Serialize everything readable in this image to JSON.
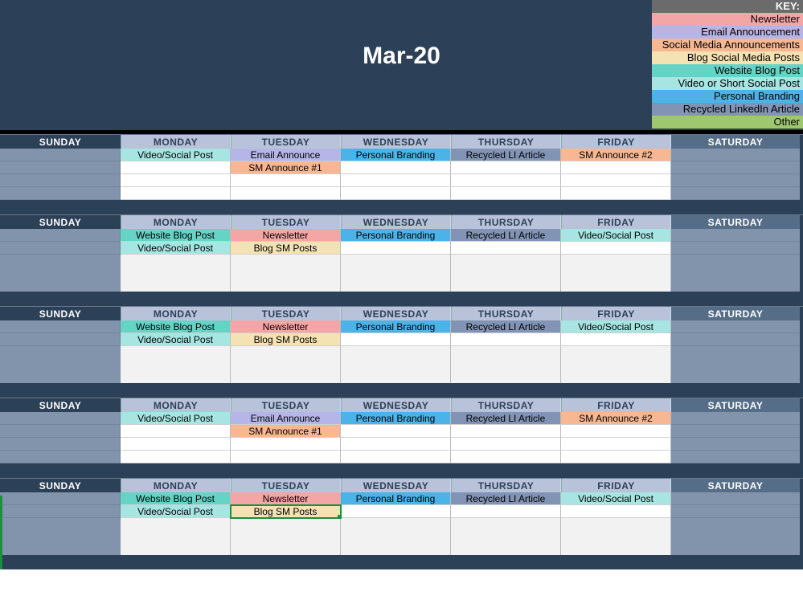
{
  "title": "Mar-20",
  "key": {
    "label": "KEY:",
    "items": [
      {
        "label": "Newsletter",
        "class": "c-newsletter"
      },
      {
        "label": "Email Announcement",
        "class": "c-email"
      },
      {
        "label": "Social Media Announcements",
        "class": "c-sm-ann"
      },
      {
        "label": "Blog Social Media Posts",
        "class": "c-blog-sm"
      },
      {
        "label": "Website Blog Post",
        "class": "c-web-blog"
      },
      {
        "label": "Video or Short Social Post",
        "class": "c-video"
      },
      {
        "label": "Personal Branding",
        "class": "c-personal"
      },
      {
        "label": "Recycled LinkedIn Article",
        "class": "c-recycled"
      },
      {
        "label": "Other",
        "class": "c-other"
      }
    ]
  },
  "days": [
    "SUNDAY",
    "MONDAY",
    "TUESDAY",
    "WEDNESDAY",
    "THURSDAY",
    "FRIDAY",
    "SATURDAY"
  ],
  "weeks": [
    {
      "rows": 4,
      "tail": false,
      "cols": [
        [],
        [
          {
            "t": "Video/Social Post",
            "c": "c-video"
          }
        ],
        [
          {
            "t": "Email Announce",
            "c": "c-email"
          },
          {
            "t": "SM Announce #1",
            "c": "c-sm-ann"
          }
        ],
        [
          {
            "t": "Personal Branding",
            "c": "c-personal"
          }
        ],
        [
          {
            "t": "Recycled LI Article",
            "c": "c-recycled"
          }
        ],
        [
          {
            "t": "SM Announce #2",
            "c": "c-sm-ann"
          }
        ],
        []
      ]
    },
    {
      "rows": 2,
      "tail": true,
      "cols": [
        [],
        [
          {
            "t": "Website Blog Post",
            "c": "c-web-blog"
          },
          {
            "t": "Video/Social Post",
            "c": "c-video"
          }
        ],
        [
          {
            "t": "Newsletter",
            "c": "c-newsletter"
          },
          {
            "t": "Blog SM Posts",
            "c": "c-blog-sm"
          }
        ],
        [
          {
            "t": "Personal Branding",
            "c": "c-personal"
          }
        ],
        [
          {
            "t": "Recycled LI Article",
            "c": "c-recycled"
          }
        ],
        [
          {
            "t": "Video/Social Post",
            "c": "c-video"
          }
        ],
        []
      ]
    },
    {
      "rows": 2,
      "tail": true,
      "cols": [
        [],
        [
          {
            "t": "Website Blog Post",
            "c": "c-web-blog"
          },
          {
            "t": "Video/Social Post",
            "c": "c-video"
          }
        ],
        [
          {
            "t": "Newsletter",
            "c": "c-newsletter"
          },
          {
            "t": "Blog SM Posts",
            "c": "c-blog-sm"
          }
        ],
        [
          {
            "t": "Personal Branding",
            "c": "c-personal"
          }
        ],
        [
          {
            "t": "Recycled LI Article",
            "c": "c-recycled"
          }
        ],
        [
          {
            "t": "Video/Social Post",
            "c": "c-video"
          }
        ],
        []
      ]
    },
    {
      "rows": 4,
      "tail": false,
      "cols": [
        [],
        [
          {
            "t": "Video/Social Post",
            "c": "c-video"
          }
        ],
        [
          {
            "t": "Email Announce",
            "c": "c-email"
          },
          {
            "t": "SM Announce #1",
            "c": "c-sm-ann"
          }
        ],
        [
          {
            "t": "Personal Branding",
            "c": "c-personal"
          }
        ],
        [
          {
            "t": "Recycled LI Article",
            "c": "c-recycled"
          }
        ],
        [
          {
            "t": "SM Announce #2",
            "c": "c-sm-ann"
          }
        ],
        []
      ]
    },
    {
      "rows": 2,
      "tail": true,
      "cols": [
        [],
        [
          {
            "t": "Website Blog Post",
            "c": "c-web-blog"
          },
          {
            "t": "Video/Social Post",
            "c": "c-video"
          }
        ],
        [
          {
            "t": "Newsletter",
            "c": "c-newsletter"
          },
          {
            "t": "Blog SM Posts",
            "c": "c-blog-sm",
            "selected": true
          }
        ],
        [
          {
            "t": "Personal Branding",
            "c": "c-personal"
          }
        ],
        [
          {
            "t": "Recycled LI Article",
            "c": "c-recycled"
          }
        ],
        [
          {
            "t": "Video/Social Post",
            "c": "c-video"
          }
        ],
        []
      ]
    }
  ]
}
